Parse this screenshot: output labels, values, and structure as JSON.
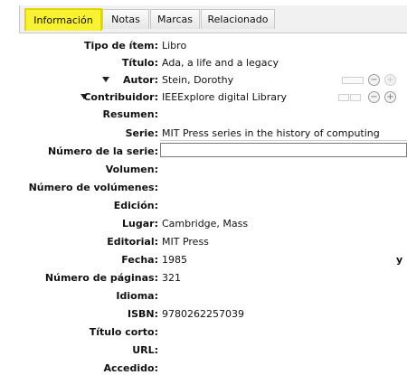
{
  "tabs": [
    {
      "label": "Información",
      "active": true
    },
    {
      "label": "Notas",
      "active": false
    },
    {
      "label": "Marcas",
      "active": false
    },
    {
      "label": "Relacionado",
      "active": false
    }
  ],
  "colors": {
    "highlight": "#f8f232",
    "highlight_border": "#e1d400"
  },
  "fields": {
    "tipo": {
      "label": "Tipo de ítem:",
      "value": "Libro"
    },
    "titulo": {
      "label": "Título:",
      "value": "Ada, a life and a legacy"
    },
    "autor": {
      "label": "Autor:",
      "value": "Stein, Dorothy"
    },
    "contribuidor": {
      "label": "Contribuidor:",
      "value": "IEEExplore digital Library"
    },
    "resumen": {
      "label": "Resumen:",
      "value": ""
    },
    "serie": {
      "label": "Serie:",
      "value": "MIT Press series in the history of computing"
    },
    "numero_serie": {
      "label": "Número de la serie:",
      "value": ""
    },
    "volumen": {
      "label": "Volumen:",
      "value": ""
    },
    "num_volumenes": {
      "label": "Número de volúmenes:",
      "value": ""
    },
    "edicion": {
      "label": "Edición:",
      "value": ""
    },
    "lugar": {
      "label": "Lugar:",
      "value": "Cambridge, Mass"
    },
    "editorial": {
      "label": "Editorial:",
      "value": "MIT Press"
    },
    "fecha": {
      "label": "Fecha:",
      "value": "1985",
      "right_marker": "y"
    },
    "num_paginas": {
      "label": "Número de páginas:",
      "value": "321"
    },
    "idioma": {
      "label": "Idioma:",
      "value": ""
    },
    "isbn": {
      "label": "ISBN:",
      "value": "9780262257039"
    },
    "titulo_corto": {
      "label": "Título corto:",
      "value": ""
    },
    "url": {
      "label": "URL:",
      "value": ""
    },
    "accedido": {
      "label": "Accedido:",
      "value": ""
    }
  },
  "icons": {
    "remove": "−",
    "add": "+"
  }
}
